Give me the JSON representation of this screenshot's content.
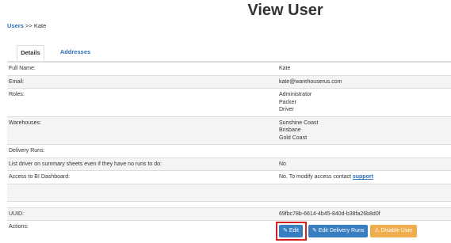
{
  "page": {
    "title": "View User"
  },
  "breadcrumb": {
    "parent": "Users",
    "separator": ">>",
    "current": "Kate"
  },
  "tabs": [
    {
      "label": "Details"
    },
    {
      "label": "Addresses"
    }
  ],
  "details": {
    "full_name": {
      "label": "Full Name:",
      "value": "Kate"
    },
    "email": {
      "label": "Email:",
      "value": "kate@warehouserus.com"
    },
    "roles": {
      "label": "Roles:",
      "values": [
        "Administrator",
        "Packer",
        "Driver"
      ]
    },
    "warehouses": {
      "label": "Warehouses:",
      "values": [
        "Sunshine Coast",
        "Brisbane",
        "Gold Coast"
      ]
    },
    "delivery_runs": {
      "label": "Delivery Runs:",
      "value": ""
    },
    "summary_sheets": {
      "label": "List driver on summary sheets even if they have no runs to do:",
      "value": "No"
    },
    "bi_dashboard": {
      "label": "Access to BI Dashboard:",
      "value": "No. To modify access contact ",
      "link": "support"
    },
    "uuid": {
      "label": "UUID:",
      "value": "69fbc78b-6614-4b45-840d-b38fa26b8d0f"
    },
    "actions": {
      "label": "Actions:"
    }
  },
  "actions": {
    "edit": {
      "label": "Edit",
      "icon": "pencil-icon"
    },
    "edit_runs": {
      "label": "Edit Delivery Runs",
      "icon": "pencil-icon"
    },
    "disable": {
      "label": "Disable User",
      "icon": "warning-icon"
    }
  },
  "colors": {
    "link": "#2a6db5",
    "button_blue": "#3a7ec2",
    "button_orange": "#f0ad4e",
    "highlight": "#d32020"
  }
}
